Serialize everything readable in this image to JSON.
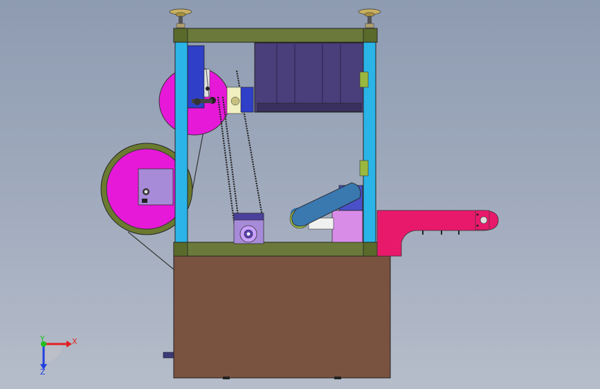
{
  "viewport": {
    "background_top": "#8e9bb1",
    "background_bottom": "#b6bdca"
  },
  "triad": {
    "x_label": "X",
    "y_label": "Y",
    "z_label": "Z",
    "x_color": "#e02020",
    "y_color": "#20c020",
    "z_color": "#2040e0"
  },
  "colors": {
    "frame_beam": "#6b7a3a",
    "frame_post": "#2ab4e8",
    "base_cabinet": "#7a5240",
    "reel": "#e619d8",
    "reel_rim": "#6b7a30",
    "motor_box": "#4a3f7a",
    "arm": "#e8196b",
    "slider": "#d88ce8",
    "belt_link": "#3a78b0"
  }
}
